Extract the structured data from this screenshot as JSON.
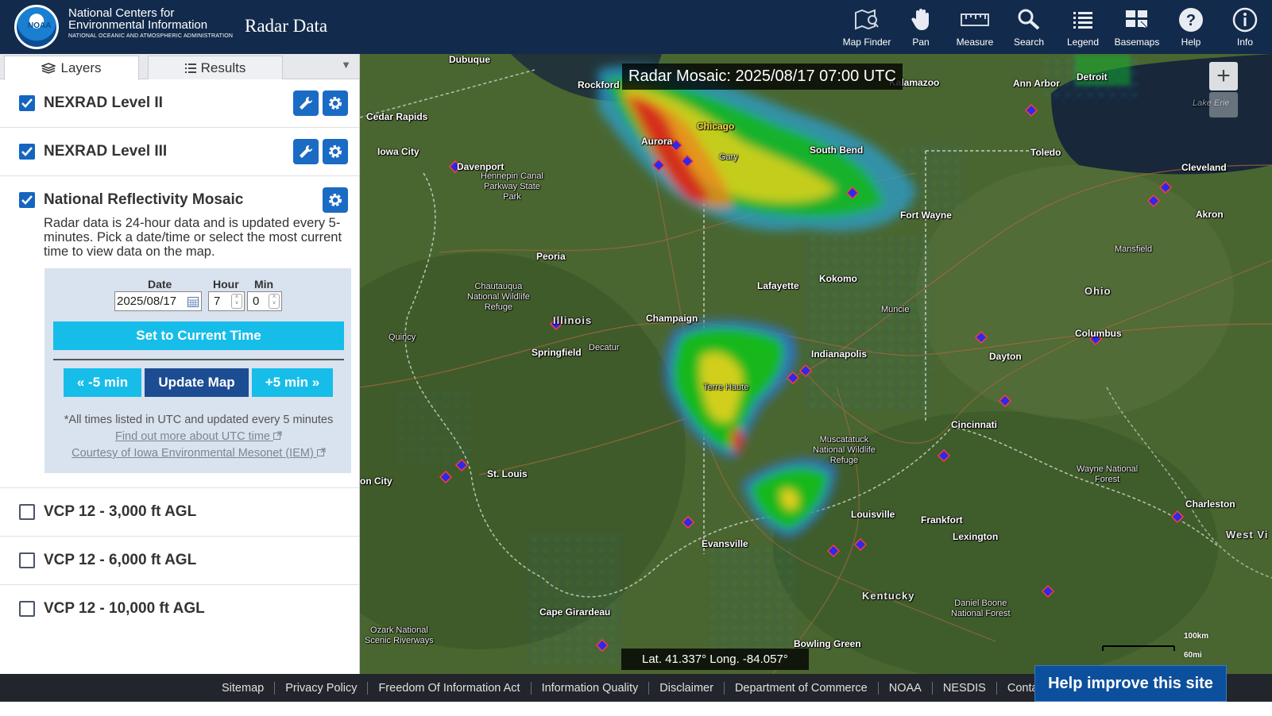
{
  "header": {
    "logo_text": "NOAA",
    "org_line1": "National Centers for",
    "org_line2": "Environmental Information",
    "org_sub": "NATIONAL OCEANIC AND ATMOSPHERIC ADMINISTRATION",
    "app_title": "Radar Data",
    "tools": [
      {
        "label": "Map Finder",
        "icon": "map-finder-icon"
      },
      {
        "label": "Pan",
        "icon": "hand-icon"
      },
      {
        "label": "Measure",
        "icon": "ruler-icon"
      },
      {
        "label": "Search",
        "icon": "search-icon"
      },
      {
        "label": "Legend",
        "icon": "list-icon"
      },
      {
        "label": "Basemaps",
        "icon": "basemap-icon"
      },
      {
        "label": "Help",
        "icon": "help-icon"
      },
      {
        "label": "Info",
        "icon": "info-icon"
      }
    ]
  },
  "panel": {
    "tabs": [
      {
        "label": "Layers",
        "active": true
      },
      {
        "label": "Results",
        "active": false
      }
    ],
    "tab_menu_glyph": "▼",
    "layers": [
      {
        "name": "NEXRAD Level II",
        "checked": true
      },
      {
        "name": "NEXRAD Level III",
        "checked": true
      },
      {
        "name": "National Reflectivity Mosaic",
        "checked": true
      },
      {
        "name": "VCP 12 - 3,000 ft AGL",
        "checked": false
      },
      {
        "name": "VCP 12 - 6,000 ft AGL",
        "checked": false
      },
      {
        "name": "VCP 12 - 10,000 ft AGL",
        "checked": false
      }
    ],
    "mosaic": {
      "description": "Radar data is 24-hour data and is updated every 5-minutes. Pick a date/time or select the most current time to view data on the map.",
      "date_label": "Date",
      "date_value": "2025/08/17",
      "hour_label": "Hour",
      "hour_value": "7",
      "min_label": "Min",
      "min_value": "0",
      "set_current_label": "Set to Current Time",
      "minus_label": "« -5 min",
      "update_label": "Update Map",
      "plus_label": "+5 min »",
      "note": "*All times listed in UTC and updated every 5 minutes",
      "utc_link": "Find out more about UTC time",
      "iem_link": "Courtesy of Iowa Environmental Mesonet (IEM)"
    }
  },
  "map": {
    "title": "Radar Mosaic: 2025/08/17 07:00 UTC",
    "coords": "Lat. 41.337°  Long. -84.057°",
    "zoom_in_glyph": "+",
    "scale_km": "100km",
    "scale_mi": "60mi",
    "cities": [
      {
        "id": "dubuque",
        "name": "Dubuque"
      },
      {
        "id": "rockford",
        "name": "Rockford"
      },
      {
        "id": "cedar-rapids",
        "name": "Cedar Rapids"
      },
      {
        "id": "iowa-city",
        "name": "Iowa City"
      },
      {
        "id": "davenport",
        "name": "Davenport"
      },
      {
        "id": "aurora",
        "name": "Aurora"
      },
      {
        "id": "chicago",
        "name": "Chicago"
      },
      {
        "id": "gary",
        "name": "Gary"
      },
      {
        "id": "south-bend",
        "name": "South Bend"
      },
      {
        "id": "toledo",
        "name": "Toledo"
      },
      {
        "id": "ann-arbor",
        "name": "Ann Arbor"
      },
      {
        "id": "detroit",
        "name": "Detroit"
      },
      {
        "id": "kalamazoo",
        "name": "Kalamazoo"
      },
      {
        "id": "cleveland",
        "name": "Cleveland"
      },
      {
        "id": "akron",
        "name": "Akron"
      },
      {
        "id": "fort-wayne",
        "name": "Fort Wayne"
      },
      {
        "id": "mansfield",
        "name": "Mansfield"
      },
      {
        "id": "peoria",
        "name": "Peoria"
      },
      {
        "id": "lafayette",
        "name": "Lafayette"
      },
      {
        "id": "kokomo",
        "name": "Kokomo"
      },
      {
        "id": "muncie",
        "name": "Muncie"
      },
      {
        "id": "champaign",
        "name": "Champaign"
      },
      {
        "id": "quincy",
        "name": "Quincy"
      },
      {
        "id": "springfield",
        "name": "Springfield"
      },
      {
        "id": "decatur",
        "name": "Decatur"
      },
      {
        "id": "indianapolis",
        "name": "Indianapolis"
      },
      {
        "id": "terre-haute",
        "name": "Terre Haute"
      },
      {
        "id": "dayton",
        "name": "Dayton"
      },
      {
        "id": "columbus",
        "name": "Columbus"
      },
      {
        "id": "cincinnati",
        "name": "Cincinnati"
      },
      {
        "id": "st-louis",
        "name": "St. Louis"
      },
      {
        "id": "jefferson-city",
        "name": "on City"
      },
      {
        "id": "louisville",
        "name": "Louisville"
      },
      {
        "id": "frankfort",
        "name": "Frankfort"
      },
      {
        "id": "lexington",
        "name": "Lexington"
      },
      {
        "id": "evansville",
        "name": "Evansville"
      },
      {
        "id": "cape-girardeau",
        "name": "Cape Girardeau"
      },
      {
        "id": "bowling-green",
        "name": "Bowling Green"
      },
      {
        "id": "charleston",
        "name": "Charleston"
      }
    ],
    "states": [
      {
        "id": "illinois",
        "name": "Illinois"
      },
      {
        "id": "ohio",
        "name": "Ohio"
      },
      {
        "id": "kentucky",
        "name": "Kentucky"
      },
      {
        "id": "west-virginia",
        "name": "West Vi"
      }
    ],
    "parks": [
      {
        "id": "hennepin",
        "name": "Hennepin Canal\nParkway State\nPark"
      },
      {
        "id": "chautauqua",
        "name": "Chautauqua\nNational Wildlife\nRefuge"
      },
      {
        "id": "muscatatuck",
        "name": "Muscatatuck\nNational Wildlife\nRefuge"
      },
      {
        "id": "wayne",
        "name": "Wayne National\nForest"
      },
      {
        "id": "daniel-boone",
        "name": "Daniel Boone\nNational Forest"
      },
      {
        "id": "ozark",
        "name": "Ozark National\nScenic Riverways"
      },
      {
        "id": "lake-erie",
        "name": "Lake Erie"
      }
    ]
  },
  "footer": {
    "links": [
      "Sitemap",
      "Privacy Policy",
      "Freedom Of Information Act",
      "Information Quality",
      "Disclaimer",
      "Department of Commerce",
      "NOAA",
      "NESDIS",
      "Contact Us"
    ],
    "help_button": "Help improve this site"
  }
}
